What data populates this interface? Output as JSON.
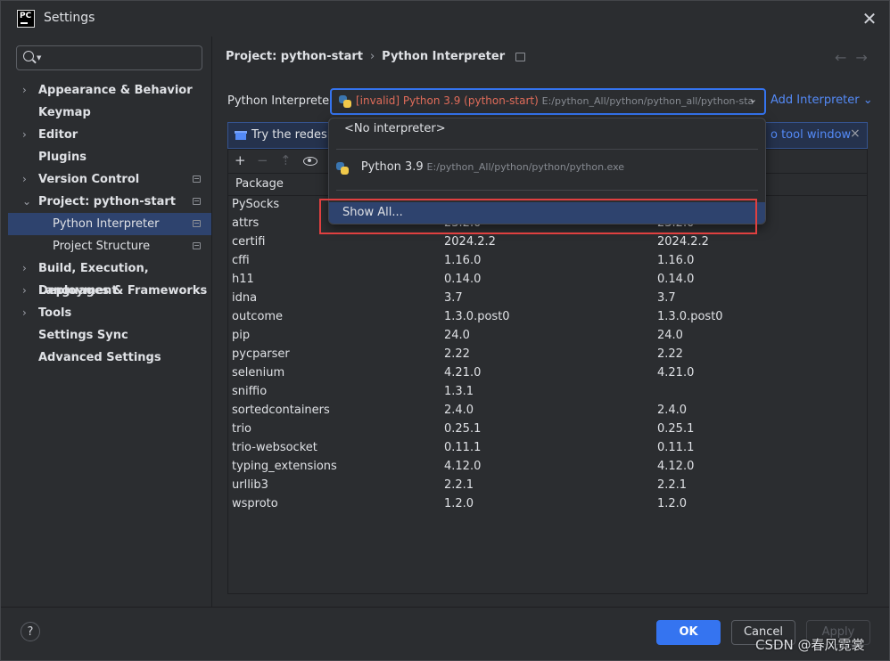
{
  "window": {
    "title": "Settings",
    "app_logo_text": "PC"
  },
  "sidebar": {
    "search_placeholder": "",
    "items": [
      {
        "label": "Appearance & Behavior"
      },
      {
        "label": "Keymap"
      },
      {
        "label": "Editor"
      },
      {
        "label": "Plugins"
      },
      {
        "label": "Version Control"
      },
      {
        "label": "Project: python-start"
      },
      {
        "label": "Python Interpreter"
      },
      {
        "label": "Project Structure"
      },
      {
        "label": "Build, Execution, Deployment"
      },
      {
        "label": "Languages & Frameworks"
      },
      {
        "label": "Tools"
      },
      {
        "label": "Settings Sync"
      },
      {
        "label": "Advanced Settings"
      }
    ]
  },
  "breadcrumb": {
    "parent": "Project: python-start",
    "sep": "›",
    "current": "Python Interpreter",
    "back": "←",
    "forward": "→"
  },
  "interpreter": {
    "label": "Python Interpreter:",
    "invalid_tag": "[invalid]",
    "name": "Python 3.9 (python-start)",
    "path": "E:/python_All/python/python_all/python-sta",
    "chevron": "⌄",
    "add_label": "Add Interpreter",
    "add_chevron": "⌄"
  },
  "banner": {
    "text": "Try the redesig",
    "link": "o tool window",
    "close": "×"
  },
  "toolbar": {
    "add": "+",
    "remove": "−",
    "upgrade": "⇡"
  },
  "table": {
    "headers": [
      "Package",
      "",
      ""
    ],
    "rows": [
      [
        "PySocks",
        "",
        ""
      ],
      [
        "attrs",
        "23.2.0",
        "23.2.0"
      ],
      [
        "certifi",
        "2024.2.2",
        "2024.2.2"
      ],
      [
        "cffi",
        "1.16.0",
        "1.16.0"
      ],
      [
        "h11",
        "0.14.0",
        "0.14.0"
      ],
      [
        "idna",
        "3.7",
        "3.7"
      ],
      [
        "outcome",
        "1.3.0.post0",
        "1.3.0.post0"
      ],
      [
        "pip",
        "24.0",
        "24.0"
      ],
      [
        "pycparser",
        "2.22",
        "2.22"
      ],
      [
        "selenium",
        "4.21.0",
        "4.21.0"
      ],
      [
        "sniffio",
        "1.3.1",
        ""
      ],
      [
        "sortedcontainers",
        "2.4.0",
        "2.4.0"
      ],
      [
        "trio",
        "0.25.1",
        "0.25.1"
      ],
      [
        "trio-websocket",
        "0.11.1",
        "0.11.1"
      ],
      [
        "typing_extensions",
        "4.12.0",
        "4.12.0"
      ],
      [
        "urllib3",
        "2.2.1",
        "2.2.1"
      ],
      [
        "wsproto",
        "1.2.0",
        "1.2.0"
      ]
    ]
  },
  "dropdown": {
    "no_interpreter": "<No interpreter>",
    "python_name": "Python 3.9",
    "python_path": "E:/python_All/python/python/python.exe",
    "show_all": "Show All..."
  },
  "footer": {
    "help": "?",
    "ok": "OK",
    "cancel": "Cancel",
    "apply": "Apply"
  },
  "watermark": "CSDN @春风霓裳",
  "colors": {
    "accent": "#3574f0",
    "selection": "#2e436e",
    "invalid": "#e06c5a",
    "link": "#548af7",
    "highlight_box": "#e04040"
  }
}
